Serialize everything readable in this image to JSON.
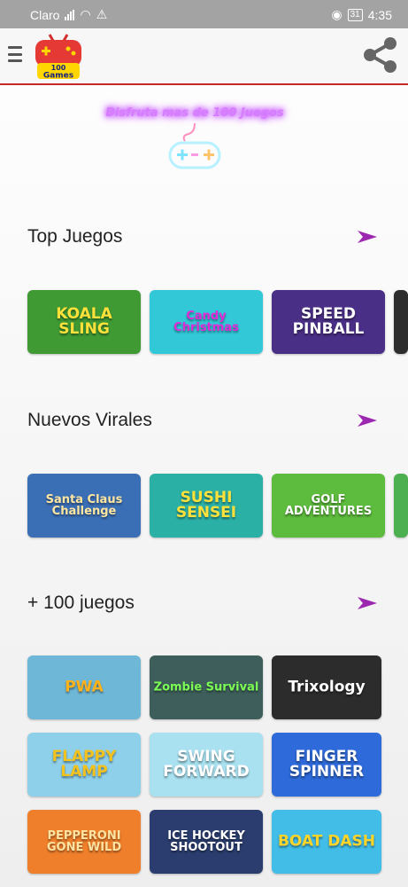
{
  "status": {
    "carrier": "Claro",
    "battery": "31",
    "time": "4:35"
  },
  "app": {
    "logo_top": "100",
    "logo_bottom": "Games"
  },
  "banner": {
    "text": "Disfruta mas de 100 Juegos"
  },
  "sections": [
    {
      "title": "Top Juegos",
      "games": [
        {
          "title": "KOALA SLING",
          "bg": "#3f9a34",
          "fg": "#ffe13b"
        },
        {
          "title": "Candy Christmas",
          "bg": "#33c8d8",
          "fg": "#e12ad8"
        },
        {
          "title": "SPEED PINBALL",
          "bg": "#4a2f86",
          "fg": "#ffffff"
        }
      ]
    },
    {
      "title": "Nuevos Virales",
      "games": [
        {
          "title": "Santa Claus Challenge",
          "bg": "#3b6fb5",
          "fg": "#ffe7a3"
        },
        {
          "title": "SUSHI SENSEI",
          "bg": "#2bb0a6",
          "fg": "#ffe13b"
        },
        {
          "title": "GOLF ADVENTURES",
          "bg": "#5dbb3d",
          "fg": "#ffffff"
        }
      ]
    },
    {
      "title": "+ 100 juegos",
      "games": [
        {
          "title": "PWA",
          "bg": "#6fb7d6",
          "fg": "#ffb21b"
        },
        {
          "title": "Zombie Survival",
          "bg": "#3d5e5a",
          "fg": "#7cff55"
        },
        {
          "title": "Trixology",
          "bg": "#2c2c2c",
          "fg": "#ffffff"
        },
        {
          "title": "FLAPPY LAMP",
          "bg": "#8ed0ea",
          "fg": "#f3c21d"
        },
        {
          "title": "SWING FORWARD",
          "bg": "#a9e1f1",
          "fg": "#ffffff"
        },
        {
          "title": "FINGER SPINNER",
          "bg": "#2e6ad9",
          "fg": "#ffffff"
        },
        {
          "title": "PEPPERONI GONE WILD",
          "bg": "#f07f2b",
          "fg": "#ffe3a0"
        },
        {
          "title": "ICE HOCKEY SHOOTOUT",
          "bg": "#2a3d6e",
          "fg": "#ffffff"
        },
        {
          "title": "BOAT DASH",
          "bg": "#42bde7",
          "fg": "#ffd52a"
        }
      ]
    }
  ],
  "colors": {
    "accent": "#9c27b0",
    "appbar_border": "#c62828"
  }
}
